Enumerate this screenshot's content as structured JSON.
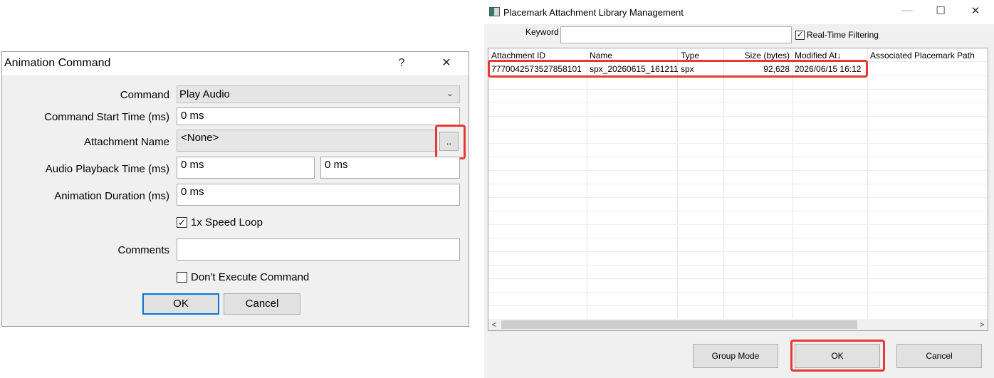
{
  "animation_dialog": {
    "title": "Animation Command",
    "help_glyph": "?",
    "close_glyph": "✕",
    "command_label": "Command",
    "command_value": "Play Audio",
    "start_time_label": "Command Start Time (ms)",
    "start_time_value": "0 ms",
    "attachment_label": "Attachment Name",
    "attachment_value": "<None>",
    "browse_label": "..",
    "playback_label": "Audio Playback Time (ms)",
    "playback_start": "0 ms",
    "playback_end": "0 ms",
    "duration_label": "Animation Duration (ms)",
    "duration_value": "0 ms",
    "speed_loop_label": "1x Speed Loop",
    "speed_loop_checked": true,
    "comments_label": "Comments",
    "comments_value": "",
    "dont_execute_label": "Don't Execute Command",
    "dont_execute_checked": false,
    "ok_label": "OK",
    "cancel_label": "Cancel"
  },
  "library_window": {
    "title": "Placemark Attachment Library Management",
    "minimize_glyph": "—",
    "maximize_glyph": "☐",
    "close_glyph": "✕",
    "keyword_label": "Keyword",
    "keyword_value": "",
    "realtime_label": "Real-Time Filtering",
    "realtime_checked": true,
    "columns": [
      "Attachment ID",
      "Name",
      "Type",
      "Size (bytes)",
      "Modified At↓",
      "Associated Placemark Path"
    ],
    "rows": [
      {
        "id": "7770042573527858101",
        "name": "spx_20260615_161211",
        "type": "spx",
        "size": "92,628",
        "modified": "2026/06/15 16:12",
        "path": ""
      }
    ],
    "scroll_left": "<",
    "scroll_right": ">",
    "group_mode_label": "Group Mode",
    "ok_label": "OK",
    "cancel_label": "Cancel"
  },
  "highlight_color": "#e53935",
  "accent_color": "#0078d7"
}
